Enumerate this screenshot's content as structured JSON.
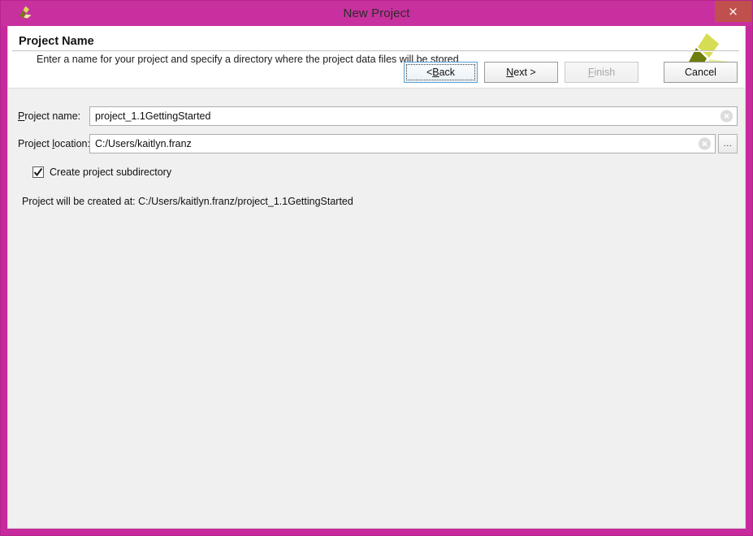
{
  "window": {
    "title": "New Project",
    "icon": "vivado-logo-icon",
    "close_label": "×",
    "frame_color": "#c9309f",
    "close_color": "#c0504d",
    "client_bg": "#f0f0f0"
  },
  "header": {
    "title": "Project Name",
    "subtitle": "Enter a name for your project and specify a directory where the project data files will be stored",
    "logo": "vivado-logo-icon",
    "logo_colors": [
      "#6f7d0c",
      "#d6dd52",
      "#e9eda1"
    ]
  },
  "form": {
    "name_field": {
      "label_pre": "P",
      "label_post": "roject name:",
      "value": "project_1.1GettingStarted",
      "clear_icon": "clear-circle-icon"
    },
    "location_field": {
      "label_pre": "Project ",
      "label_mnemonic": "l",
      "label_post": "ocation:",
      "value": "C:/Users/kaitlyn.franz",
      "clear_icon": "clear-circle-icon",
      "browse_label": "..."
    },
    "subdirectory_checkbox": {
      "label": "Create project subdirectory",
      "checked": true
    },
    "status_text": "Project will be created at: C:/Users/kaitlyn.franz/project_1.1GettingStarted"
  },
  "footer": {
    "buttons": [
      {
        "name": "back",
        "pre": "< ",
        "mnemonic": "B",
        "post": "ack",
        "state": "focused"
      },
      {
        "name": "next",
        "pre": "",
        "mnemonic": "N",
        "post": "ext >",
        "state": "normal"
      },
      {
        "name": "finish",
        "pre": "",
        "mnemonic": "F",
        "post": "inish",
        "state": "disabled"
      },
      {
        "name": "cancel",
        "pre": "Cancel",
        "mnemonic": "",
        "post": "",
        "state": "normal"
      }
    ]
  }
}
